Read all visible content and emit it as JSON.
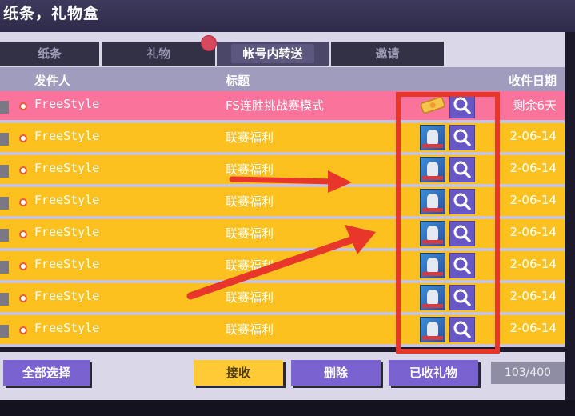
{
  "window": {
    "title": "纸条，礼物盒"
  },
  "tabs": [
    {
      "label": "纸条",
      "active": false
    },
    {
      "label": "礼物",
      "active": false,
      "has_badge": true
    },
    {
      "label": "帐号内转送",
      "active": true
    },
    {
      "label": "邀请",
      "active": false
    }
  ],
  "columns": {
    "sender": "发件人",
    "subject": "标题",
    "date": "收件日期"
  },
  "rows": [
    {
      "sender": "FreeStyle",
      "subject": "FS连胜挑战赛模式",
      "date": "剩余6天",
      "item_icon": "ticket-icon",
      "highlight": true
    },
    {
      "sender": "FreeStyle",
      "subject": "联赛福利",
      "date": "2-06-14",
      "item_icon": "character-card-icon"
    },
    {
      "sender": "FreeStyle",
      "subject": "联赛福利",
      "date": "2-06-14",
      "item_icon": "character-card-icon"
    },
    {
      "sender": "FreeStyle",
      "subject": "联赛福利",
      "date": "2-06-14",
      "item_icon": "character-card-icon"
    },
    {
      "sender": "FreeStyle",
      "subject": "联赛福利",
      "date": "2-06-14",
      "item_icon": "character-card-icon"
    },
    {
      "sender": "FreeStyle",
      "subject": "联赛福利",
      "date": "2-06-14",
      "item_icon": "character-card-icon"
    },
    {
      "sender": "FreeStyle",
      "subject": "联赛福利",
      "date": "2-06-14",
      "item_icon": "character-card-icon"
    },
    {
      "sender": "FreeStyle",
      "subject": "联赛福利",
      "date": "2-06-14",
      "item_icon": "character-card-icon"
    }
  ],
  "footer": {
    "select_all": "全部选择",
    "receive": "接收",
    "delete": "删除",
    "received_gifts": "已收礼物",
    "count": "103/400"
  },
  "colors": {
    "row_normal": "#fcc11f",
    "row_highlight": "#f9739b",
    "button_purple": "#7a62d0",
    "button_yellow": "#ffca35",
    "annotation_red": "#e8362a"
  }
}
